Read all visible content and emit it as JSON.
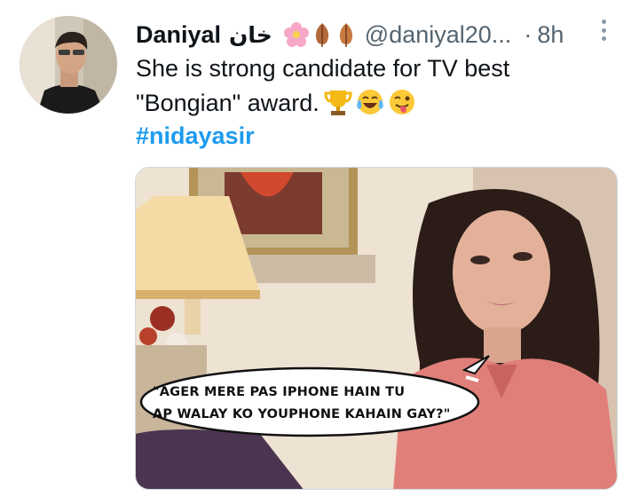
{
  "tweet": {
    "display_name": "Daniyal",
    "display_name_urdu": "خان",
    "handle": "@daniyal20...",
    "separator": "·",
    "timestamp": "8h",
    "text_line1": "She is strong candidate for TV best",
    "text_line2": "\"Bongian\" award.",
    "hashtag": "#nidayasir",
    "badge_icons": [
      "cherry-blossom-icon",
      "fallen-leaf-icon",
      "fallen-leaf-icon"
    ],
    "reaction_icons": [
      "trophy-icon",
      "tears-of-joy-icon",
      "winking-tongue-icon"
    ]
  },
  "media": {
    "speech_bubble_line1": "\"AGER MERE PAS IPHONE HAIN TU",
    "speech_bubble_line2": "AP WALAY KO YOUPHONE KAHAIN GAY?\""
  },
  "colors": {
    "link": "#1d9bf0",
    "secondary_text": "#536471",
    "primary_text": "#0f1419"
  }
}
